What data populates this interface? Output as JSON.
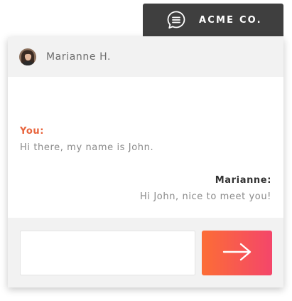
{
  "brand": {
    "name": "ACME CO.",
    "icon": "chat-bubble-icon"
  },
  "header": {
    "contact_name": "Marianne H.",
    "avatar": "avatar-photo"
  },
  "messages": [
    {
      "author": "You:",
      "text": "Hi there, my name is John.",
      "side": "left",
      "author_color": "#e8643c"
    },
    {
      "author": "Marianne:",
      "text": "Hi John, nice to meet you!",
      "side": "right",
      "author_color": "#333333"
    }
  ],
  "composer": {
    "input_value": "",
    "send_icon": "arrow-right-icon"
  },
  "colors": {
    "brand_bar": "#3f3f3f",
    "accent": "#e8643c",
    "send_gradient_start": "#fc6d36",
    "send_gradient_end": "#f4466a",
    "panel_bg": "#f2f2f2"
  }
}
